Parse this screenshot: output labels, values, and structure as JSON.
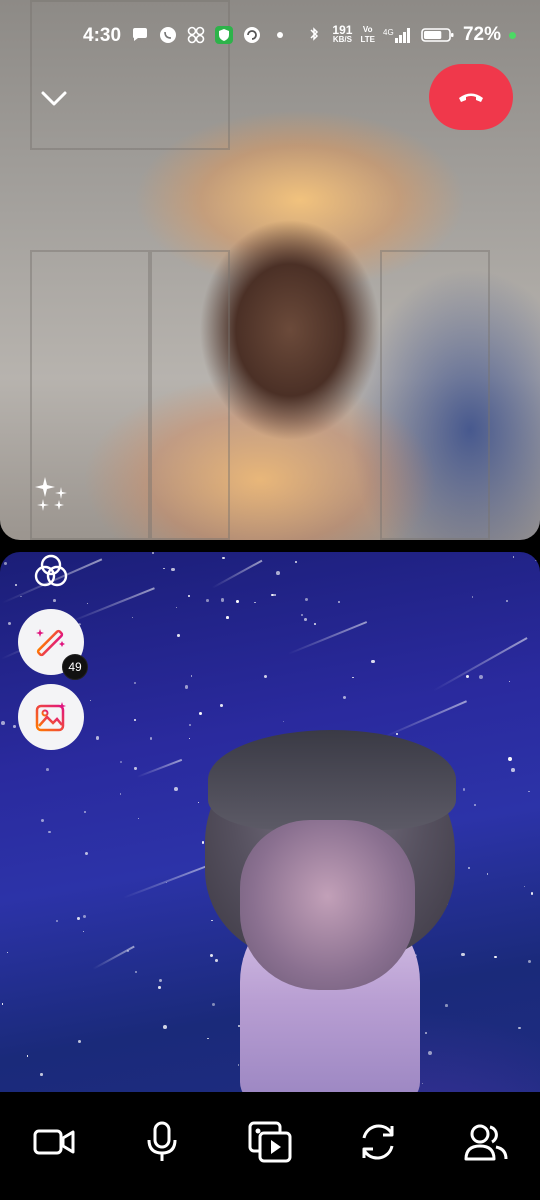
{
  "status_bar": {
    "time": "4:30",
    "left_icons": [
      "chat-bubble-icon",
      "whatsapp-icon",
      "pinwheel-icon",
      "shield-app-icon",
      "refresh-app-icon",
      "dot-icon"
    ],
    "net_speed_value": "191",
    "net_speed_unit": "KB/S",
    "volte_top": "Vo",
    "volte_bottom": "LTE",
    "network_type": "4G",
    "battery_percent": "72%",
    "battery_level": 0.72
  },
  "call": {
    "remote_video_label": "Remote participant video",
    "local_video_label": "Your video"
  },
  "side_controls": {
    "effects_count": "49"
  },
  "colors": {
    "end_call": "#f0384b",
    "toolbar_background": "#000000",
    "badge_background": "#111111"
  },
  "toolbar": {
    "buttons": [
      {
        "icon": "video-camera-icon"
      },
      {
        "icon": "microphone-icon"
      },
      {
        "icon": "media-share-icon"
      },
      {
        "icon": "flip-camera-icon"
      },
      {
        "icon": "add-participant-icon"
      }
    ]
  }
}
